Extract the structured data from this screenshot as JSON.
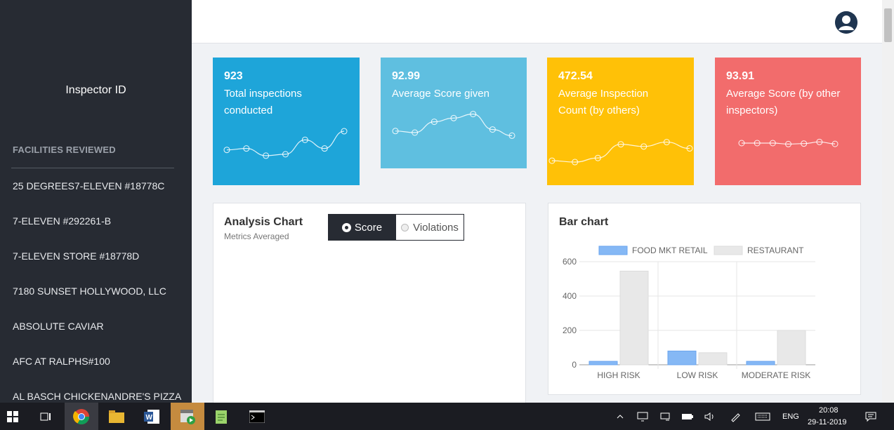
{
  "sidebar": {
    "inspector_label": "Inspector ID",
    "section_title": "FACILITIES REVIEWED",
    "facilities": [
      "25 DEGREES7-ELEVEN #18778C",
      "7-ELEVEN #292261-B",
      "7-ELEVEN STORE #18778D",
      "7180 SUNSET HOLLYWOOD, LLC",
      "ABSOLUTE CAVIAR",
      "AFC AT RALPHS#100",
      "AL BASCH CHICKENANDRE'S PIZZA"
    ]
  },
  "cards": [
    {
      "value": "923",
      "label": "Total inspections conducted",
      "color": "#1ea5d9",
      "points": [
        0.3,
        0.35,
        0.1,
        0.15,
        0.65,
        0.35,
        0.95
      ]
    },
    {
      "value": "92.99",
      "label": "Average Score given",
      "color": "#5fbfe0",
      "points": [
        0.3,
        0.25,
        0.6,
        0.72,
        0.85,
        0.35,
        0.15
      ]
    },
    {
      "value": "472.54",
      "label": "Average Inspection Count (by others)",
      "color": "#ffc107",
      "points": [
        0.1,
        0.05,
        0.2,
        0.7,
        0.62,
        0.78,
        0.55
      ]
    },
    {
      "value": "93.91",
      "label": "Average Score (by other inspectors)",
      "color": "#f26c6c",
      "points": [
        0.5,
        0.5,
        0.5,
        0.4,
        0.45,
        0.62,
        0.42
      ]
    }
  ],
  "analysis": {
    "title": "Analysis Chart",
    "subtitle": "Metrics Averaged",
    "options": [
      "Score",
      "Violations"
    ],
    "selected": "Score"
  },
  "bar_panel": {
    "title": "Bar chart"
  },
  "chart_data": {
    "type": "bar",
    "title": "",
    "categories": [
      "HIGH RISK",
      "LOW RISK",
      "MODERATE RISK"
    ],
    "series": [
      {
        "name": "FOOD MKT RETAIL",
        "values": [
          20,
          80,
          20
        ],
        "color": "#85b8f5"
      },
      {
        "name": "RESTAURANT",
        "values": [
          545,
          70,
          200
        ],
        "color": "#e8e8e8"
      }
    ],
    "yticks": [
      "600",
      "400",
      "200",
      "0"
    ],
    "ylim": [
      0,
      600
    ],
    "legend": "top",
    "grid": true
  },
  "taskbar": {
    "lang": "ENG",
    "time": "20:08",
    "date": "29-11-2019"
  }
}
